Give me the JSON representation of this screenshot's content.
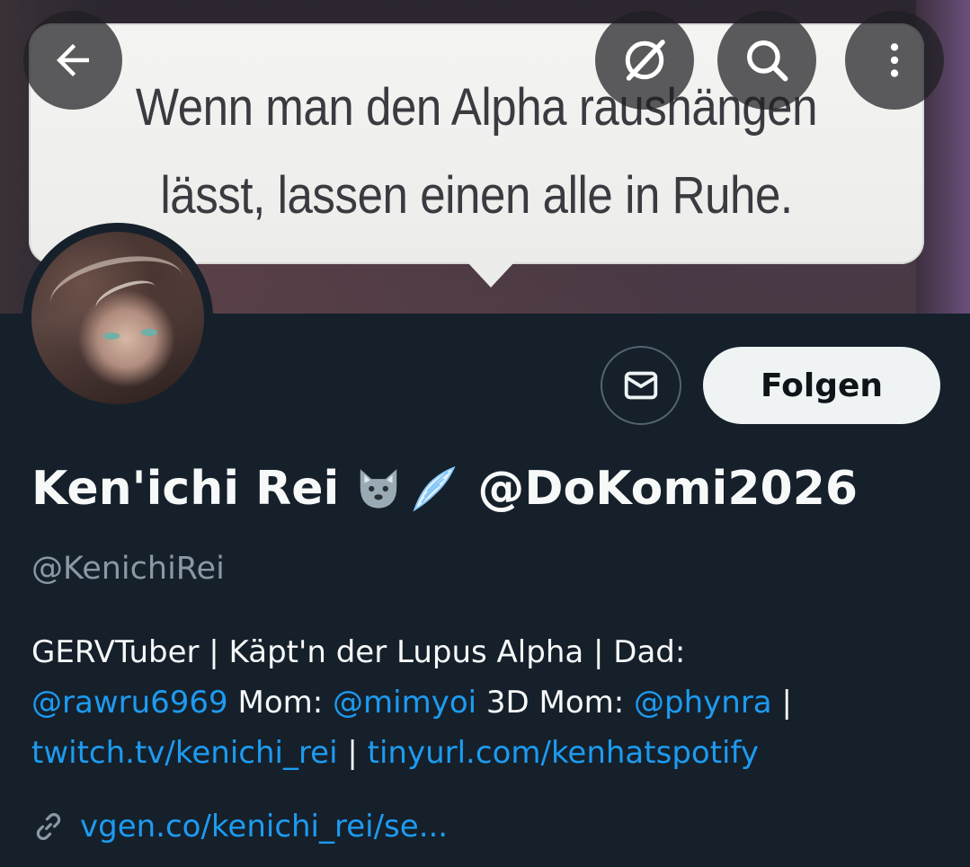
{
  "banner": {
    "line1": "Wenn man den Alpha raushängen",
    "line2": "lässt, lassen einen alle in Ruhe."
  },
  "toolbar": {
    "back_icon": "arrow-left-icon",
    "grok_icon": "grok-icon",
    "search_icon": "search-icon",
    "more_icon": "more-vertical-icon"
  },
  "profile": {
    "name": "Ken'ichi Rei",
    "name_emoji_1": "🐺",
    "name_emoji_2": "🪽",
    "name_suffix": "@DoKomi2026",
    "handle": "@KenichiRei",
    "follow_label": "Folgen",
    "message_icon": "envelope-icon"
  },
  "bio": {
    "line1": "GERVTuber | Käpt'n der Lupus Alpha | Dad:",
    "line2": [
      {
        "text": "@rawru6969",
        "link": true
      },
      {
        "text": " Mom: ",
        "link": false
      },
      {
        "text": "@mimyoi",
        "link": true
      },
      {
        "text": " 3D Mom: ",
        "link": false
      },
      {
        "text": "@phynra",
        "link": true
      },
      {
        "text": " |",
        "link": false
      }
    ],
    "line3": [
      {
        "text": "twitch.tv/kenichi_rei",
        "link": true
      },
      {
        "text": " | ",
        "link": false
      },
      {
        "text": "tinyurl.com/kenhatspotify",
        "link": true
      }
    ]
  },
  "website": {
    "icon": "link-icon",
    "url": "vgen.co/kenichi_rei/se..."
  },
  "colors": {
    "background": "#15202b",
    "link": "#1d9bf0",
    "secondary_text": "#8b98a5",
    "primary_text": "#f7f9f9"
  }
}
